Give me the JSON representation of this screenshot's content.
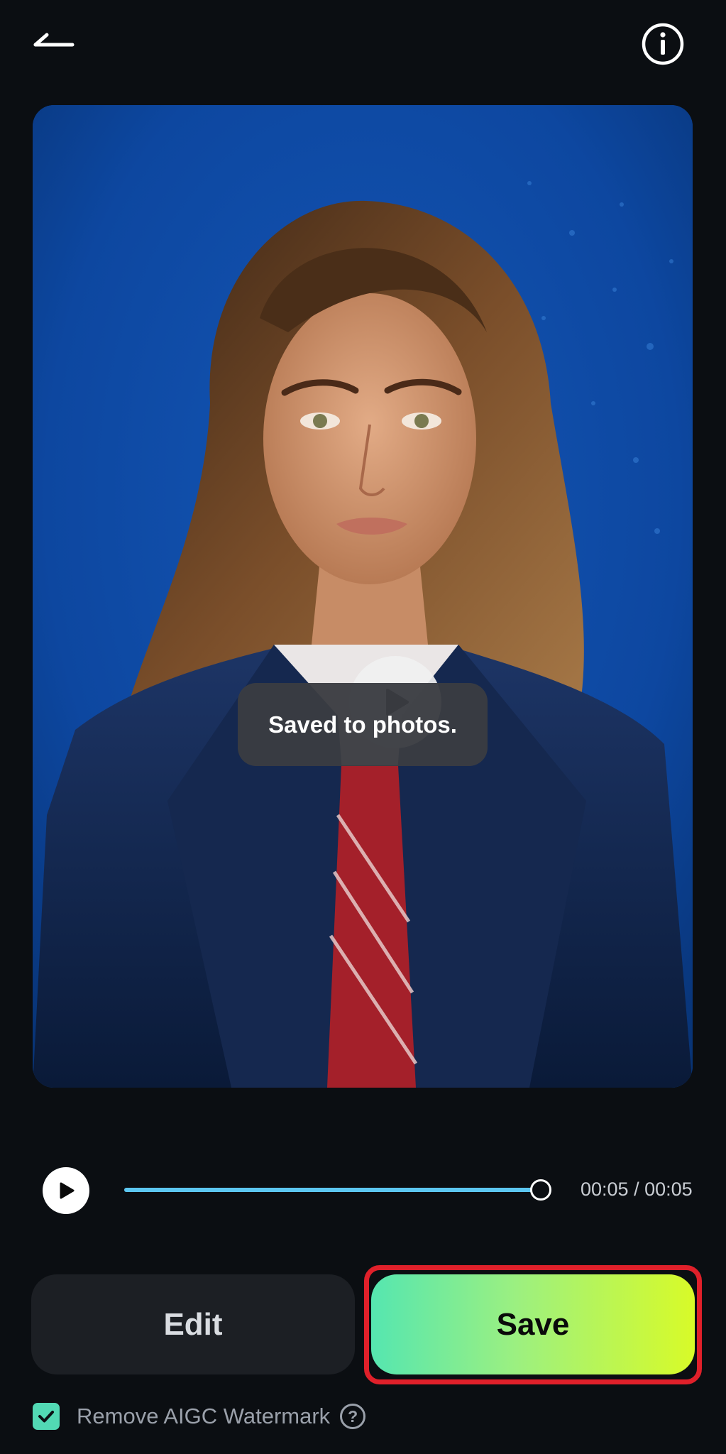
{
  "header": {
    "back_icon": "back-arrow-icon",
    "info_icon": "info-icon"
  },
  "preview": {
    "content": "portrait-photo",
    "center_play_icon": "play-icon"
  },
  "toast": {
    "message": "Saved to photos."
  },
  "player": {
    "play_icon": "play-icon",
    "progress": 1.0,
    "time": "00:05 / 00:05"
  },
  "actions": {
    "edit_label": "Edit",
    "save_label": "Save"
  },
  "watermark": {
    "checked": true,
    "label": "Remove AIGC Watermark",
    "help_icon": "question-circle-icon",
    "help_glyph": "?"
  },
  "colors": {
    "background": "#0b0e12",
    "accent_progress": "#5cc6f0",
    "save_gradient_start": "#55e6b0",
    "save_gradient_end": "#d8fb28",
    "checkbox": "#52d9b4",
    "highlight_outline": "#e0202a"
  }
}
